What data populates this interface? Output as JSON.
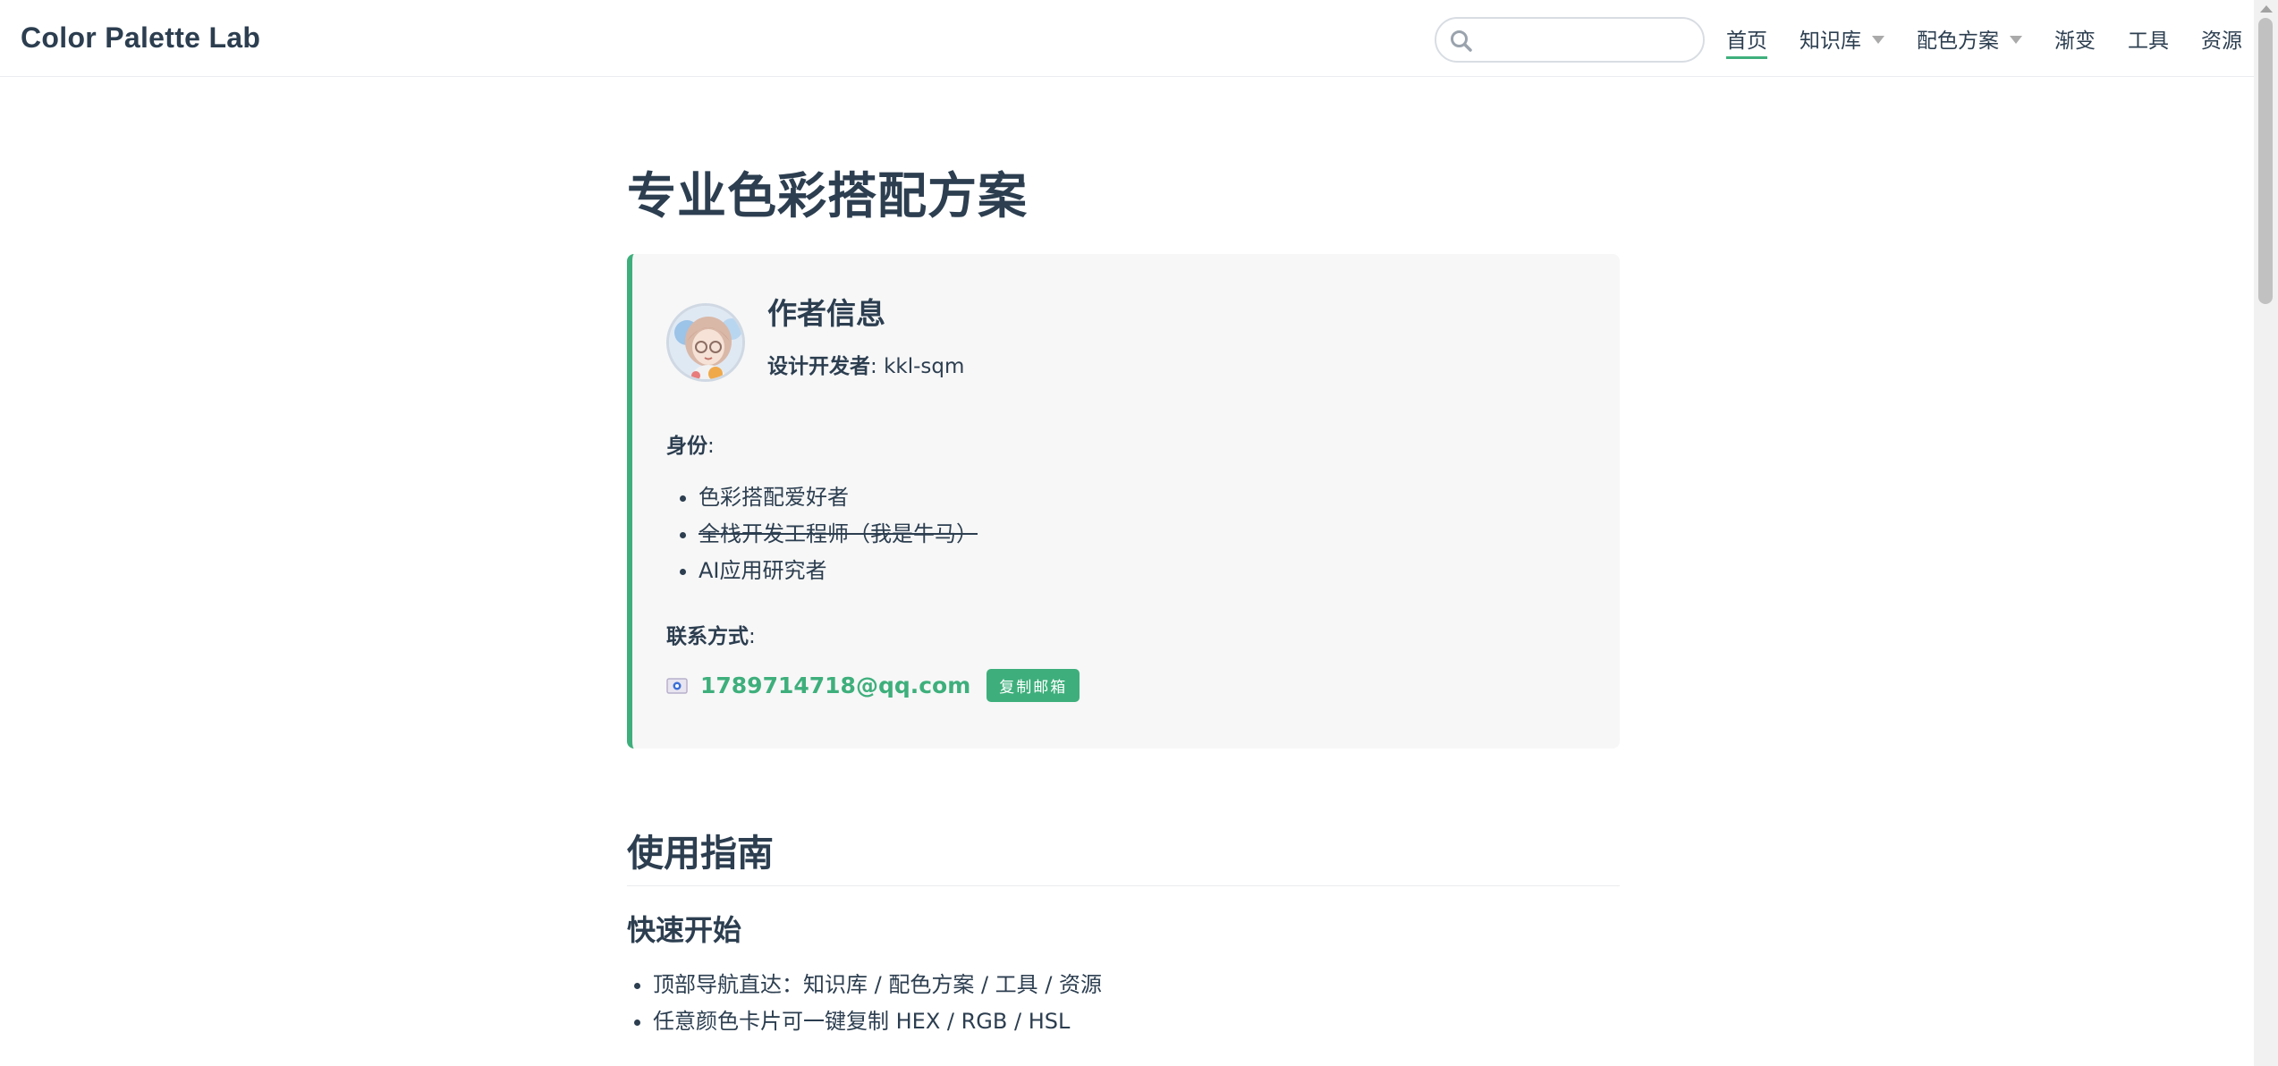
{
  "header": {
    "site_name": "Color Palette Lab",
    "search": {
      "placeholder": "",
      "value": ""
    },
    "nav": [
      {
        "label": "首页",
        "active": true,
        "dropdown": false
      },
      {
        "label": "知识库",
        "active": false,
        "dropdown": true
      },
      {
        "label": "配色方案",
        "active": false,
        "dropdown": true
      },
      {
        "label": "渐变",
        "active": false,
        "dropdown": false
      },
      {
        "label": "工具",
        "active": false,
        "dropdown": false
      },
      {
        "label": "资源",
        "active": false,
        "dropdown": false
      }
    ]
  },
  "page": {
    "title": "专业色彩搭配方案"
  },
  "author_card": {
    "title": "作者信息",
    "developer_label": "设计开发者",
    "developer_sep": ": ",
    "developer_value": "kkl-sqm",
    "identity_label": "身份",
    "identity_colon": ":",
    "identity_items": [
      {
        "text": "色彩搭配爱好者",
        "strikethrough": false
      },
      {
        "text": "全栈开发工程师（我是牛马）",
        "strikethrough": true
      },
      {
        "text": "AI应用研究者",
        "strikethrough": false
      }
    ],
    "contact_label": "联系方式",
    "contact_colon": ":",
    "email": "1789714718@qq.com",
    "copy_button": "复制邮箱",
    "accent_color": "#3eaf7c"
  },
  "guide": {
    "title": "使用指南",
    "quick_start_title": "快速开始",
    "items": [
      "顶部导航直达：知识库 / 配色方案 / 工具 / 资源",
      "任意颜色卡片可一键复制 HEX / RGB / HSL"
    ]
  },
  "icons": {
    "search": "search-icon",
    "mail": "mail-icon",
    "dropdown": "chevron-down-icon"
  }
}
